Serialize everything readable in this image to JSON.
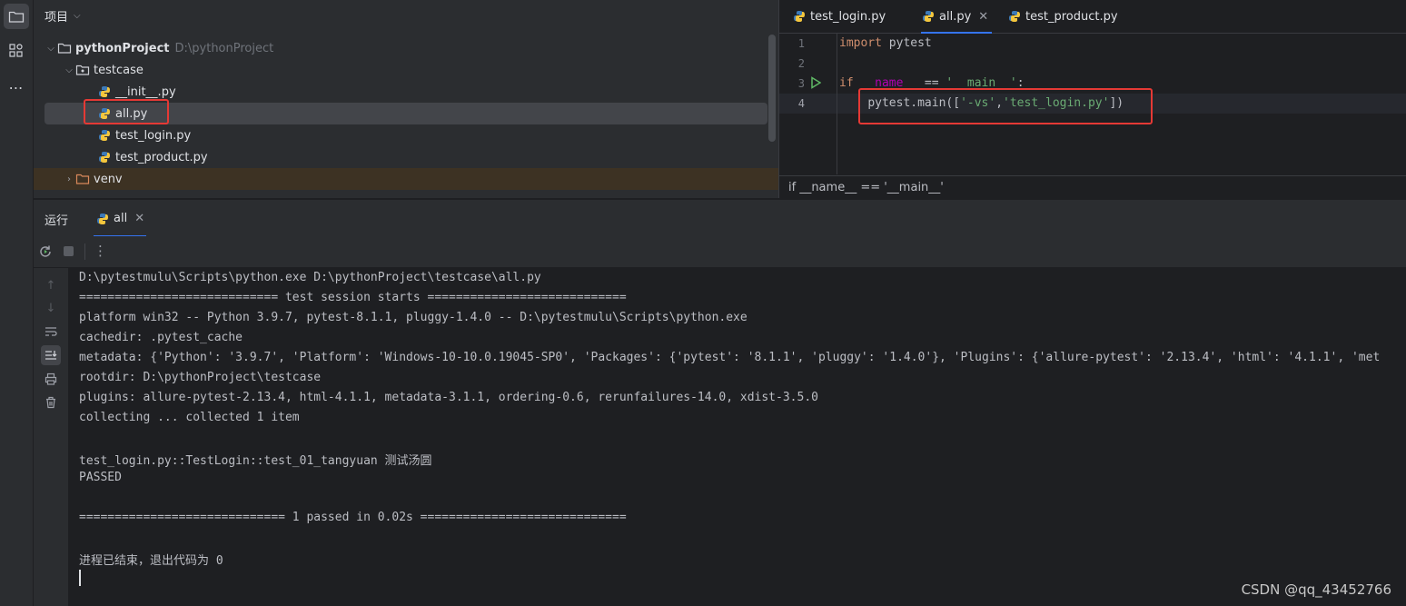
{
  "project_panel": {
    "title": "项目",
    "tree": {
      "root_name": "pythonProject",
      "root_path": "D:\\pythonProject",
      "folder": "testcase",
      "files": [
        "__init__.py",
        "all.py",
        "test_login.py",
        "test_product.py"
      ],
      "venv": "venv"
    }
  },
  "editor": {
    "tabs": [
      "test_login.py",
      "all.py",
      "test_product.py"
    ],
    "active_tab": "all.py",
    "line_numbers": [
      "1",
      "2",
      "3",
      "4"
    ],
    "code": {
      "l1_kw": "import",
      "l1_rest": " pytest",
      "l3_kw": "if",
      "l3_dunder": "__name__",
      "l3_op": " == ",
      "l3_str": "'__main__'",
      "l3_colon": ":",
      "l4_call": "pytest.main([",
      "l4_arg1": "'-vs'",
      "l4_comma": ",",
      "l4_arg2": "'test_login.py'",
      "l4_end": "])"
    },
    "breadcrumb": "if __name__ == '__main__'"
  },
  "run_panel": {
    "title": "运行",
    "tab": "all",
    "console_lines": [
      "D:\\pytestmulu\\Scripts\\python.exe D:\\pythonProject\\testcase\\all.py",
      "============================ test session starts ============================",
      "platform win32 -- Python 3.9.7, pytest-8.1.1, pluggy-1.4.0 -- D:\\pytestmulu\\Scripts\\python.exe",
      "cachedir: .pytest_cache",
      "metadata: {'Python': '3.9.7', 'Platform': 'Windows-10-10.0.19045-SP0', 'Packages': {'pytest': '8.1.1', 'pluggy': '1.4.0'}, 'Plugins': {'allure-pytest': '2.13.4', 'html': '4.1.1', 'met",
      "rootdir: D:\\pythonProject\\testcase",
      "plugins: allure-pytest-2.13.4, html-4.1.1, metadata-3.1.1, ordering-0.6, rerunfailures-14.0, xdist-3.5.0",
      "collecting ... collected 1 item",
      "",
      "test_login.py::TestLogin::test_01_tangyuan 测试汤圆",
      "PASSED",
      "",
      "============================= 1 passed in 0.02s =============================",
      "",
      "进程已结束，退出代码为 0"
    ]
  },
  "watermark": "CSDN @qq_43452766",
  "colors": {
    "highlight_box": "#e53935",
    "accent": "#3574f0",
    "keyword": "#cf8e6d",
    "string": "#6aab73",
    "dunder": "#b200b2"
  }
}
